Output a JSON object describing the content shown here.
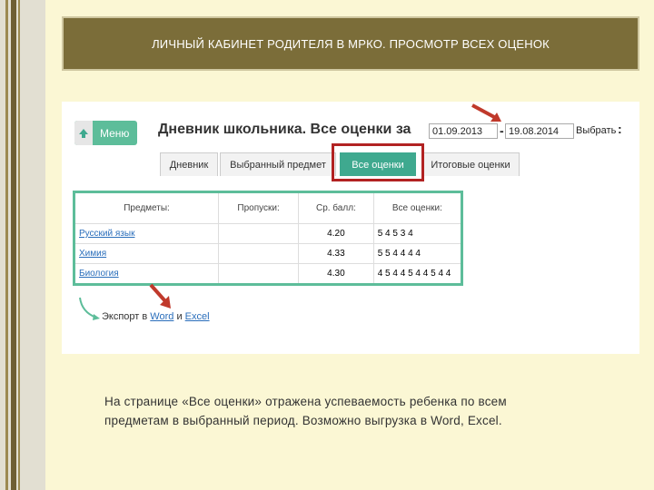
{
  "slide": {
    "title": "ЛИЧНЫЙ КАБИНЕТ РОДИТЕЛЯ В МРКО. ПРОСМОТР ВСЕХ ОЦЕНОК",
    "caption_line1": "На странице «Все оценки» отражена успеваемость ребенка по всем",
    "caption_line2": "предметам в выбранный период. Возможно выгрузка в Word, Excel."
  },
  "app": {
    "menu_label": "Меню",
    "diary_title": "Дневник школьника. Все оценки за",
    "date_from": "01.09.2013",
    "dash": "-",
    "date_to": "19.08.2014",
    "choose_label": "Выбрать",
    "colon": ":",
    "tabs": [
      {
        "label": "Дневник"
      },
      {
        "label": "Выбранный предмет"
      },
      {
        "label": "Все оценки",
        "active": true
      },
      {
        "label": "Итоговые оценки"
      }
    ],
    "table": {
      "headers": [
        "Предметы:",
        "Пропуски:",
        "Ср. балл:",
        "Все оценки:"
      ],
      "rows": [
        {
          "subject": "Русский язык",
          "skips": "",
          "avg": "4.20",
          "grades": "5 4 5 3 4"
        },
        {
          "subject": "Химия",
          "skips": "",
          "avg": "4.33",
          "grades": "5 5 4 4 4 4"
        },
        {
          "subject": "Биология",
          "skips": "",
          "avg": "4.30",
          "grades": "4 5 4 4 5 4 4 5 4 4"
        }
      ]
    },
    "export": {
      "prefix": "Экспорт в",
      "word": "Word",
      "and": "и",
      "excel": "Excel"
    }
  },
  "colors": {
    "accent": "#5dbd9a",
    "title_bar": "#7b6d39",
    "highlight": "#b22222",
    "arrow": "#c0392b"
  }
}
